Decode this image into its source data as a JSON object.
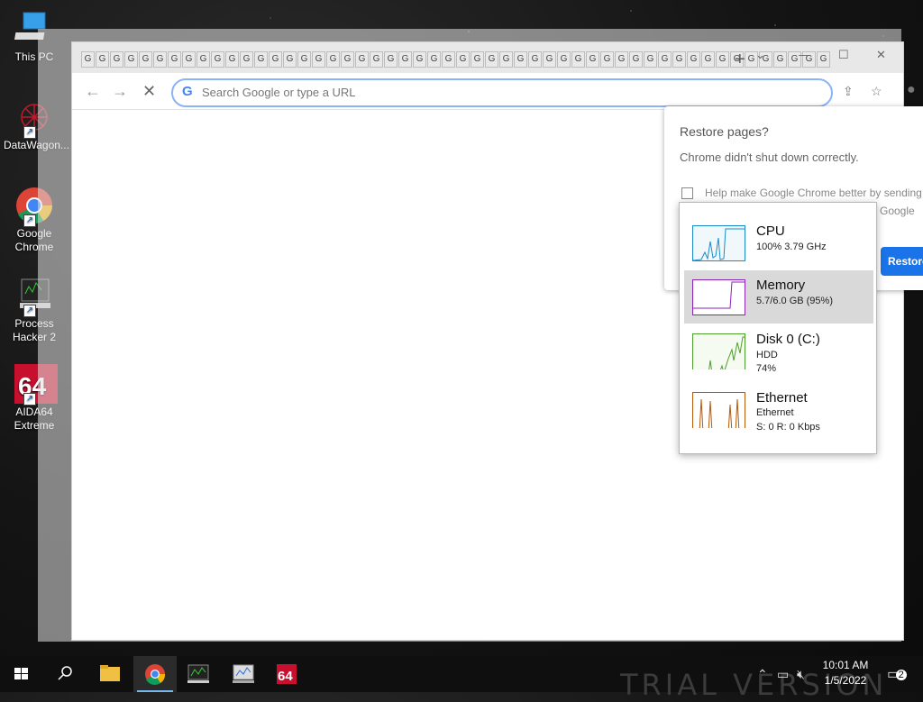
{
  "desktop": {
    "icons": [
      {
        "label": "This PC",
        "icon": "this-pc-icon"
      },
      {
        "label": "DataWagon...",
        "icon": "datawagon-icon"
      },
      {
        "label": "Google Chrome",
        "icon": "chrome-icon"
      },
      {
        "label": "Process Hacker 2",
        "icon": "process-hacker-icon"
      },
      {
        "label": "AIDA64 Extreme",
        "icon": "aida64-icon"
      }
    ]
  },
  "chrome": {
    "tab_glyph": "G",
    "new_tab": "+",
    "controls": {
      "minimize": "—",
      "maximize": "☐",
      "close": "✕"
    },
    "omnibox": {
      "g": "G",
      "placeholder": "Search Google or type a URL"
    },
    "nav": {
      "back": "←",
      "forward": "→",
      "stop": "✕"
    }
  },
  "restore_popup": {
    "title": "Restore pages?",
    "message": "Chrome didn't shut down correctly.",
    "help_text": "Help make Google Chrome better by sending",
    "help_text_2": "Google",
    "button": "Restore"
  },
  "task_manager": {
    "items": [
      {
        "name": "CPU",
        "line1": "100%  3.79 GHz",
        "line2": "",
        "color": "#1a8bc7"
      },
      {
        "name": "Memory",
        "line1": "5.7/6.0 GB (95%)",
        "line2": "",
        "color": "#8b22b8"
      },
      {
        "name": "Disk 0 (C:)",
        "line1": "HDD",
        "line2": "74%",
        "color": "#4da02b"
      },
      {
        "name": "Ethernet",
        "line1": "Ethernet",
        "line2": "S: 0  R: 0 Kbps",
        "color": "#b35a0c"
      }
    ],
    "selected": "Memory"
  },
  "taskbar": {
    "watermark": "TRIAL VERSION",
    "time": "10:01 AM",
    "date": "1/5/2022",
    "notification_count": "2",
    "apps": [
      "file-explorer-icon",
      "chrome-icon",
      "process-hacker-icon",
      "resource-monitor-icon",
      "aida64-icon"
    ]
  }
}
